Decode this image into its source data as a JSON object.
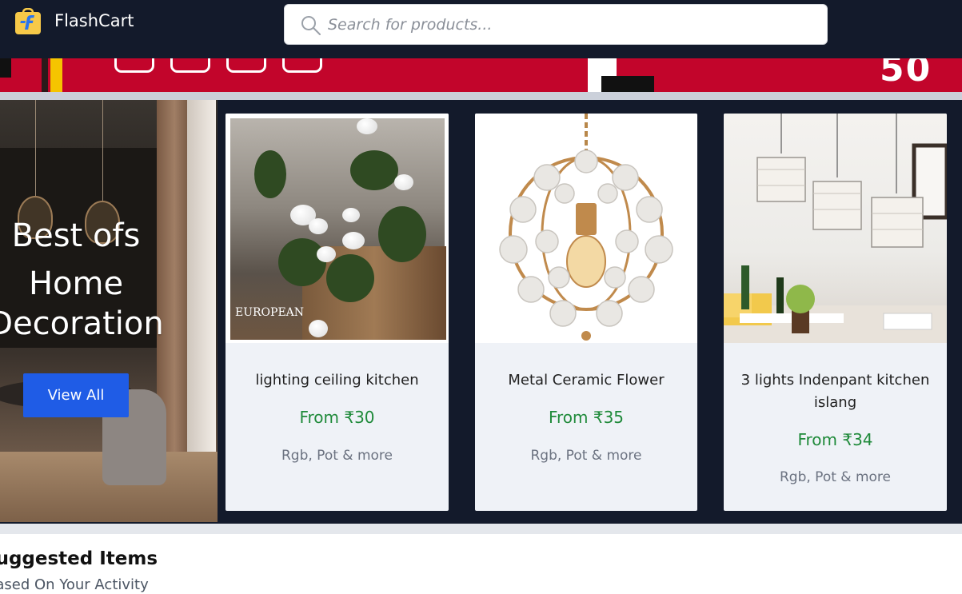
{
  "header": {
    "brand": "FlashCart",
    "search_placeholder": "Search for products..."
  },
  "banner": {
    "big_number": "50"
  },
  "hero": {
    "title_line1": "Best ofs",
    "title_line2": "Home",
    "title_line3": "Decoration",
    "button_label": "View All"
  },
  "products": [
    {
      "name": "lighting ceiling kitchen",
      "price": "From ₹30",
      "sub": "Rgb, Pot & more",
      "image_text": "EUROPEAN"
    },
    {
      "name": "Metal Ceramic Flower",
      "price": "From ₹35",
      "sub": "Rgb, Pot & more"
    },
    {
      "name": "3 lights Indenpant kitchen islang",
      "price": "From ₹34",
      "sub": "Rgb, Pot & more"
    }
  ],
  "suggested": {
    "title": "Suggested Items",
    "subtitle": "Based On Your Activity"
  },
  "icons": [
    "flipkart-logo-icon",
    "search-icon",
    "facebook-icon",
    "twitter-icon",
    "instagram-icon",
    "youtube-icon"
  ],
  "colors": {
    "header_bg": "#131a2b",
    "accent_blue": "#1f5ce6",
    "price_green": "#1f8a3a",
    "banner_red": "#c2052b"
  }
}
